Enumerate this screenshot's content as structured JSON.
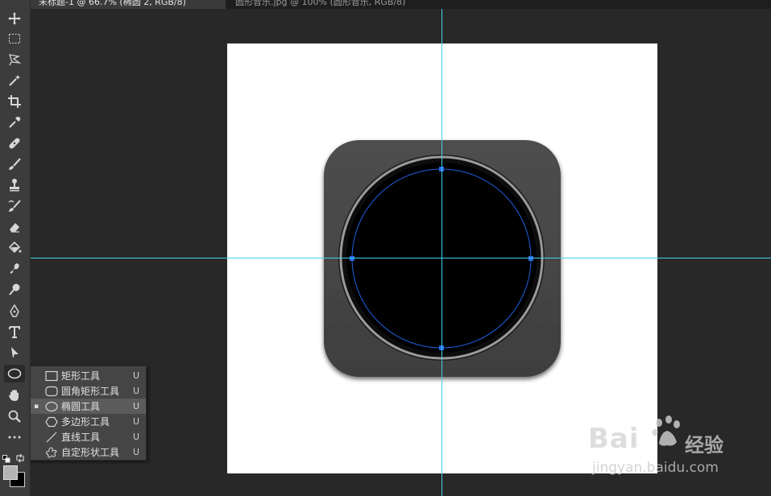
{
  "tabs": [
    {
      "label": "未标题-1 @ 66.7% (椭圆 2, RGB/8)"
    },
    {
      "label": "圆形音乐.jpg @ 100% (圆形音乐, RGB/8)"
    }
  ],
  "toolbar": {
    "tools": [
      "move-icon",
      "marquee-icon",
      "lasso-icon",
      "magic-wand-icon",
      "crop-icon",
      "eyedropper-icon",
      "healing-brush-icon",
      "brush-icon",
      "clone-stamp-icon",
      "history-brush-icon",
      "eraser-icon",
      "paint-bucket-icon",
      "smudge-icon",
      "dodge-icon",
      "pen-icon",
      "type-icon",
      "path-select-icon",
      "ellipse-icon",
      "hand-icon",
      "zoom-icon",
      "more-icon"
    ],
    "foreground_color": "#b4b4b4",
    "background_color": "#000000"
  },
  "shape_menu": {
    "items": [
      {
        "label": "矩形工具",
        "key": "U",
        "icon": "rectangle-icon",
        "selected": false
      },
      {
        "label": "圆角矩形工具",
        "key": "U",
        "icon": "rounded-rectangle-icon",
        "selected": false
      },
      {
        "label": "椭圆工具",
        "key": "U",
        "icon": "ellipse-icon",
        "selected": true
      },
      {
        "label": "多边形工具",
        "key": "U",
        "icon": "polygon-icon",
        "selected": false
      },
      {
        "label": "直线工具",
        "key": "U",
        "icon": "line-icon",
        "selected": false
      },
      {
        "label": "自定形状工具",
        "key": "U",
        "icon": "custom-shape-icon",
        "selected": false
      }
    ],
    "selected_marker": "▪"
  },
  "canvas": {
    "background": "#ffffff",
    "guide_color": "#3fd0f0",
    "path_color": "#2060e0"
  },
  "watermark": {
    "brand": "Bai",
    "brand2": "经验",
    "url": "jingyan.baidu.com"
  }
}
